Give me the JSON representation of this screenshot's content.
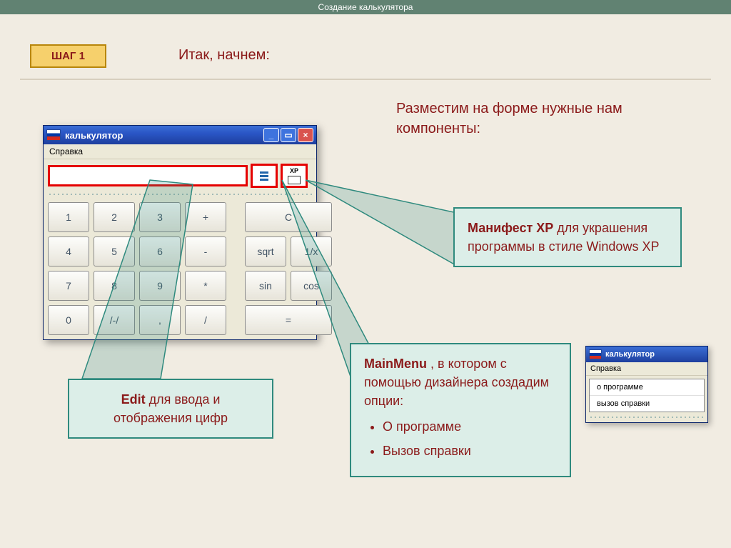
{
  "topbar": "Создание калькулятора",
  "step_label": "ШАГ 1",
  "intro": "Итак, начнем:",
  "lead": "Разместим на форме нужные нам компоненты:",
  "calc": {
    "title": "калькулятор",
    "menu": "Справка",
    "xp_label": "XP",
    "keys_row1": [
      "1",
      "2",
      "3",
      "+"
    ],
    "keys_row2": [
      "4",
      "5",
      "6",
      "-",
      "sqrt",
      "1/x"
    ],
    "keys_row3": [
      "7",
      "8",
      "9",
      "*",
      "sin",
      "cos"
    ],
    "keys_row4": [
      "0",
      "/-/",
      ",",
      "/",
      "="
    ],
    "c_label": "C"
  },
  "co_xp_bold": "Манифест XP",
  "co_xp_rest": " для украшения программы в стиле Windows XP",
  "co_mm_bold": "MainMenu",
  "co_mm_rest": " , в котором с помощью дизайнера создадим опции:",
  "co_mm_items": [
    "О программе",
    "Вызов справки"
  ],
  "co_edit_bold": "Edit",
  "co_edit_rest": " для ввода и отображения цифр",
  "mini": {
    "title": "калькулятор",
    "menu": "Справка",
    "items": [
      "о программе",
      "вызов справки"
    ]
  }
}
